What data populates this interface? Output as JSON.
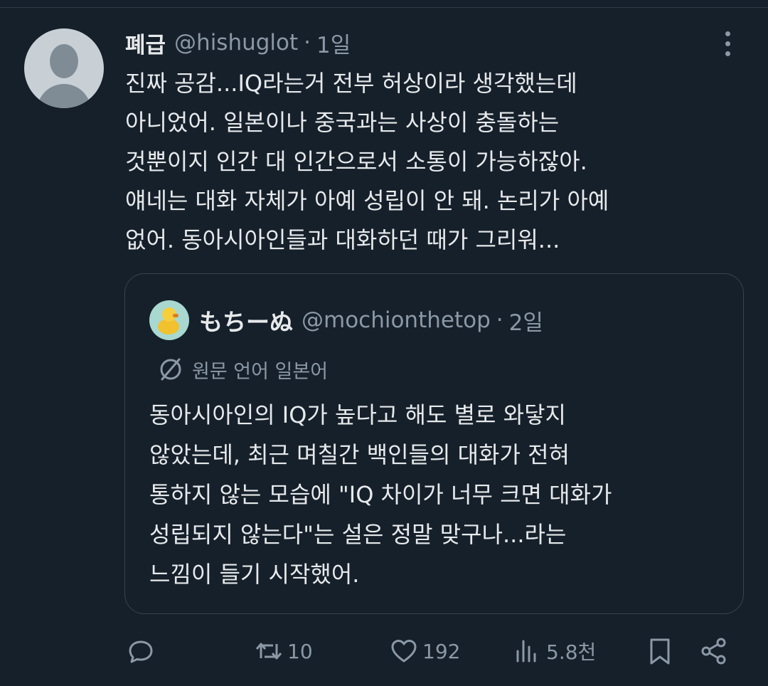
{
  "post": {
    "author_name": "폐급",
    "author_handle": "@hishuglot",
    "separator": "·",
    "time": "1일",
    "text_lines": [
      "진짜 공감...IQ라는거 전부 허상이라 생각했는데",
      "아니었어. 일본이나 중국과는 사상이 충돌하는",
      "것뿐이지 인간 대 인간으로서 소통이 가능하잖아.",
      "얘네는 대화 자체가 아예 성립이 안 돼. 논리가 아예",
      "없어. 동아시아인들과 대화하던 때가 그리워..."
    ]
  },
  "quoted_post": {
    "author_name": "もちーぬ",
    "author_handle": "@mochionthetop",
    "separator": "·",
    "time": "2일",
    "translation_label": "원문 언어 일본어",
    "text_lines": [
      "동아시아인의 IQ가 높다고 해도 별로 와닿지",
      "않았는데, 최근 며칠간 백인들의 대화가 전혀",
      "통하지 않는 모습에 \"IQ 차이가 너무 크면 대화가",
      "성립되지 않는다\"는 설은 정말 맞구나...라는",
      "느낌이 들기 시작했어."
    ]
  },
  "actions": {
    "reposts": "10",
    "likes": "192",
    "views": "5.8천"
  },
  "icons": {
    "reply": "reply-icon",
    "repost": "repost-icon",
    "like": "heart-icon",
    "views": "views-icon",
    "bookmark": "bookmark-icon",
    "share": "share-icon",
    "more": "more-icon",
    "translate": "translate-icon"
  },
  "colors": {
    "background": "#15202b",
    "text": "#e7e9ea",
    "secondary": "#8b98a5",
    "border": "#38444d"
  }
}
